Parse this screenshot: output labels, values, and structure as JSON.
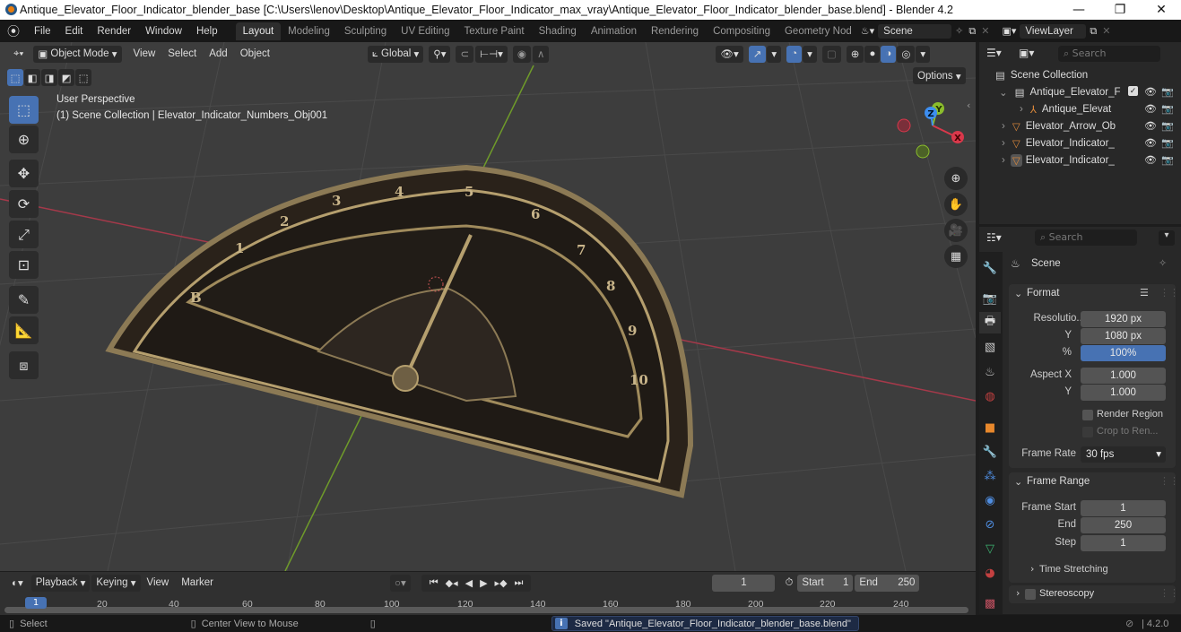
{
  "window": {
    "title": "Antique_Elevator_Floor_Indicator_blender_base [C:\\Users\\lenov\\Desktop\\Antique_Elevator_Floor_Indicator_max_vray\\Antique_Elevator_Floor_Indicator_blender_base.blend] - Blender 4.2",
    "controls": {
      "minimize": "—",
      "maximize": "❐",
      "close": "✕"
    }
  },
  "menubar": {
    "items": [
      "File",
      "Edit",
      "Render",
      "Window",
      "Help"
    ],
    "workspaces": [
      "Layout",
      "Modeling",
      "Sculpting",
      "UV Editing",
      "Texture Paint",
      "Shading",
      "Animation",
      "Rendering",
      "Compositing",
      "Geometry Nod"
    ],
    "active_workspace": "Layout",
    "scene": "Scene",
    "view_layer": "ViewLayer"
  },
  "viewport": {
    "mode": "Object Mode",
    "menus": [
      "View",
      "Select",
      "Add",
      "Object"
    ],
    "orientation": "Global",
    "options_label": "Options",
    "overlay_title": "User Perspective",
    "overlay_subtitle": "(1) Scene Collection | Elevator_Indicator_Numbers_Obj001",
    "gizmo_axes": {
      "x": "X",
      "y": "Y",
      "z": "Z"
    },
    "colors": {
      "x_axis": "#d9384b",
      "y_axis": "#8bbd2c",
      "z_axis": "#3d8ef0",
      "active_tool": "#4772b3"
    },
    "tools": [
      "select-box",
      "cursor",
      "move",
      "rotate",
      "scale",
      "transform",
      "annotate",
      "measure",
      "add-cube"
    ],
    "nav": [
      "zoom",
      "pan",
      "camera",
      "ortho-grid"
    ],
    "dial_numbers": [
      "B",
      "1",
      "2",
      "3",
      "4",
      "5",
      "6",
      "7",
      "8",
      "9",
      "10"
    ]
  },
  "outliner": {
    "search_placeholder": "Search",
    "root": "Scene Collection",
    "rows": [
      {
        "label": "Antique_Elevator_F",
        "type": "collection",
        "indent": 1,
        "checked": true
      },
      {
        "label": "Antique_Elevat",
        "type": "empty",
        "indent": 2
      },
      {
        "label": "Elevator_Arrow_Ob",
        "type": "mesh",
        "indent": 1
      },
      {
        "label": "Elevator_Indicator_",
        "type": "mesh",
        "indent": 1
      },
      {
        "label": "Elevator_Indicator_",
        "type": "mesh",
        "indent": 1,
        "selected": true
      }
    ]
  },
  "properties": {
    "search_placeholder": "Search",
    "context": "Scene",
    "format": {
      "title": "Format",
      "resolution_label": "Resolutio...",
      "resolution_x": "1920 px",
      "y_label": "Y",
      "resolution_y": "1080 px",
      "percent_label": "%",
      "percent": "100%",
      "aspect_x_label": "Aspect X",
      "aspect_x": "1.000",
      "aspect_y_label": "Y",
      "aspect_y": "1.000",
      "render_region": "Render Region",
      "crop": "Crop to Ren...",
      "frame_rate_label": "Frame Rate",
      "frame_rate": "30 fps"
    },
    "frame_range": {
      "title": "Frame Range",
      "start_label": "Frame Start",
      "start": "1",
      "end_label": "End",
      "end": "250",
      "step_label": "Step",
      "step": "1",
      "time_stretching": "Time Stretching"
    },
    "stereoscopy": "Stereoscopy"
  },
  "timeline": {
    "menus": [
      "Playback",
      "Keying",
      "View",
      "Marker"
    ],
    "current_frame": "1",
    "start_label": "Start",
    "start": "1",
    "end_label": "End",
    "end": "250",
    "ticks": [
      "20",
      "40",
      "60",
      "80",
      "100",
      "120",
      "140",
      "160",
      "180",
      "200",
      "220",
      "240"
    ],
    "playhead": "1"
  },
  "statusbar": {
    "select": "Select",
    "center": "Center View to Mouse",
    "message": "Saved \"Antique_Elevator_Floor_Indicator_blender_base.blend\"",
    "version": "4.2.0"
  }
}
